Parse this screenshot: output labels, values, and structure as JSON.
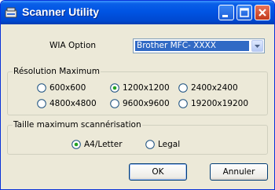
{
  "window": {
    "title": "Scanner Utility"
  },
  "title_buttons": {
    "minimize": "minimize-icon",
    "maximize": "maximize-icon",
    "close": "close-icon"
  },
  "wia": {
    "label": "WIA Option",
    "selected": "Brother MFC- XXXX"
  },
  "resolution": {
    "group_label": "Résolution Maximum",
    "options": [
      "600x600",
      "1200x1200",
      "2400x2400",
      "4800x4800",
      "9600x9600",
      "19200x19200"
    ],
    "selected": "1200x1200"
  },
  "size": {
    "group_label": "Taille maximum scannérisation",
    "options": [
      "A4/Letter",
      "Legal"
    ],
    "selected": "A4/Letter"
  },
  "buttons": {
    "ok": "OK",
    "cancel": "Annuler"
  },
  "colors": {
    "titlebar": "#0054e3",
    "face": "#ece9d8",
    "selection": "#316ac5",
    "close": "#c2391b"
  }
}
